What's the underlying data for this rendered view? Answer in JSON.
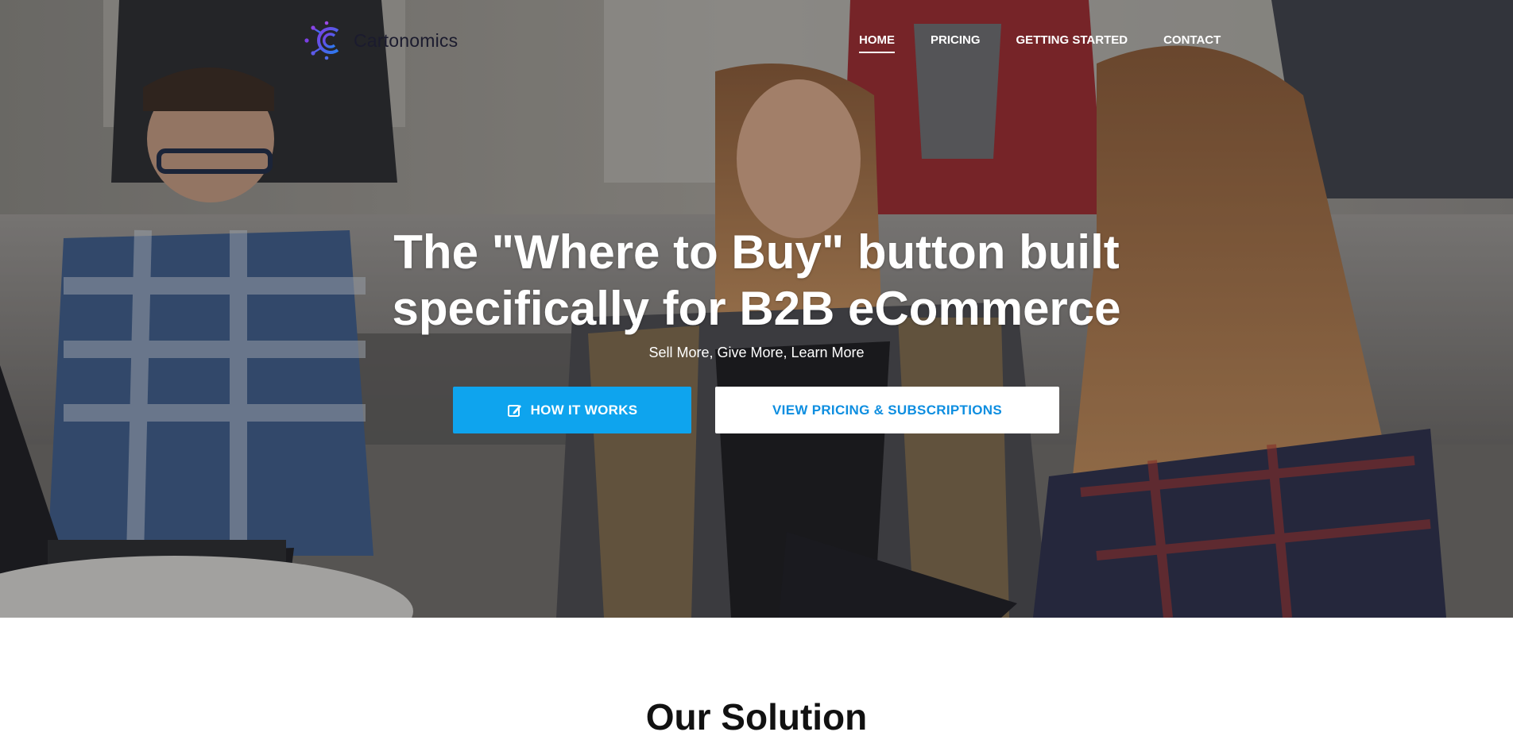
{
  "brand": {
    "name": "Cartonomics",
    "logo_icon": "circuit-c-logo",
    "colors": {
      "logo_gradient_start": "#7b3fe4",
      "logo_gradient_end": "#2b7bf0"
    }
  },
  "nav": {
    "items": [
      {
        "label": "HOME",
        "active": true
      },
      {
        "label": "PRICING",
        "active": false
      },
      {
        "label": "GETTING STARTED",
        "active": false
      },
      {
        "label": "CONTACT",
        "active": false
      }
    ]
  },
  "hero": {
    "title": "The \"Where to Buy\" button built specifically for B2B eCommerce",
    "subtitle": "Sell More, Give More, Learn More",
    "primary_button": {
      "label": "HOW IT WORKS",
      "icon": "edit-icon",
      "color": "#0ea4ee"
    },
    "secondary_button": {
      "label": "VIEW PRICING & SUBSCRIPTIONS",
      "color": "#0e8ee0"
    }
  },
  "solution": {
    "title": "Our Solution"
  }
}
